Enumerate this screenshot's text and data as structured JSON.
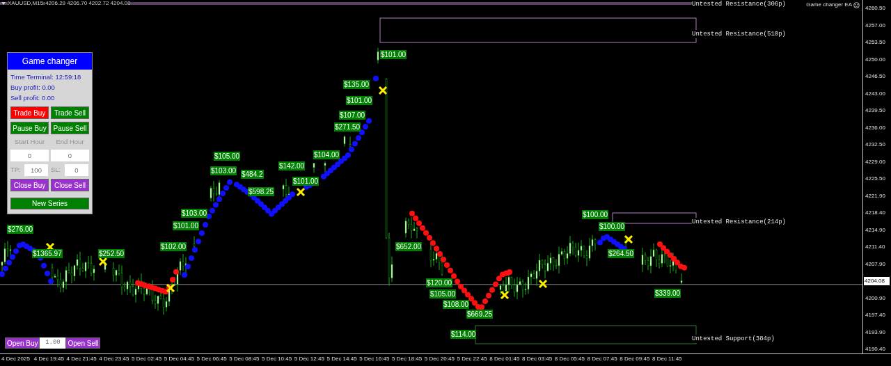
{
  "chart_header": {
    "symbol": "XAUUSD,M15",
    "quotes": "4206.29 4206.70 4202.72 4204.08"
  },
  "ea_label": "Game changer EA",
  "panel": {
    "title": "Game changer",
    "time": "Time Terminal: 12:59:18",
    "buy_profit": "Buy profit: 0.00",
    "sell_profit": "Sell profit: 0.00",
    "buttons": [
      {
        "label": "Trade Buy",
        "color": "#ff0000"
      },
      {
        "label": "Trade Sell",
        "color": "#008000"
      },
      {
        "label": "Pause Buy",
        "color": "#008000"
      },
      {
        "label": "Pause Sell",
        "color": "#008000"
      }
    ],
    "hours": [
      {
        "label": "Start Hour",
        "value": "0"
      },
      {
        "label": "End Hour",
        "value": "0"
      }
    ],
    "limits": [
      {
        "label": "TP:",
        "value": "100"
      },
      {
        "label": "SL:",
        "value": "0"
      }
    ],
    "close_buttons": [
      {
        "label": "Close Buy",
        "color": "#9932cc"
      },
      {
        "label": "Close Sell",
        "color": "#9932cc"
      }
    ],
    "new_series": {
      "label": "New Series",
      "color": "#008000"
    }
  },
  "order_bar": {
    "buy": "Open Buy",
    "lot": "1.00",
    "sell": "Open Sell"
  },
  "zones": [
    {
      "label": "Untested Resistance(306p)",
      "kind": "resistance"
    },
    {
      "label": "Untested Resistance(510p)",
      "kind": "resistance"
    },
    {
      "label": "Untested Resistance(214p)",
      "kind": "resistance"
    },
    {
      "label": "Untested Support(384p)",
      "kind": "support"
    }
  ],
  "trade_labels": [
    "$101.00",
    "$135.00",
    "$101.00",
    "$107.00",
    "$271.50",
    "$104.00",
    "$105.00",
    "$142.00",
    "$103.00",
    "$484.2",
    "$101.00",
    "$598.25",
    "$103.00",
    "$100.00",
    "$101.00",
    "$100.00",
    "$276.00",
    "$102.00",
    "$652.00",
    "$1365.97",
    "$252.50",
    "$264.50",
    "$120.00",
    "$339.00",
    "$105.00",
    "$108.00",
    "$669.25",
    "$114.00"
  ],
  "price_axis": {
    "ticks": [
      "4260.50",
      "4257.00",
      "4253.50",
      "4250.00",
      "4246.50",
      "4243.00",
      "4239.50",
      "4236.00",
      "4232.50",
      "4229.00",
      "4225.50",
      "4221.90",
      "4218.40",
      "4214.90",
      "4211.40",
      "4207.90",
      "4200.90",
      "4197.40",
      "4193.90",
      "4190.40"
    ],
    "current": "4204.08"
  },
  "time_axis": [
    "4 Dec 2025",
    "4 Dec 19:45",
    "4 Dec 21:45",
    "4 Dec 23:45",
    "5 Dec 02:45",
    "5 Dec 04:45",
    "5 Dec 06:45",
    "5 Dec 08:45",
    "5 Dec 10:45",
    "5 Dec 12:45",
    "5 Dec 14:45",
    "5 Dec 16:45",
    "5 Dec 18:45",
    "5 Dec 20:45",
    "5 Dec 22:45",
    "8 Dec 01:45",
    "8 Dec 03:45",
    "8 Dec 05:45",
    "8 Dec 07:45",
    "8 Dec 09:45",
    "8 Dec 11:45"
  ]
}
